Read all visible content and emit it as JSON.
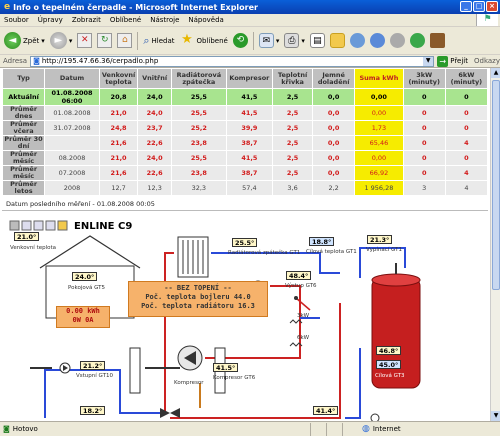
{
  "window": {
    "title": "Info o tepelném čerpadle - Microsoft Internet Explorer"
  },
  "menu": [
    "Soubor",
    "Úpravy",
    "Zobrazit",
    "Oblíbené",
    "Nástroje",
    "Nápověda"
  ],
  "toolbar": {
    "back_label": "Zpět",
    "search_label": "Hledat",
    "favorites_label": "Oblíbené"
  },
  "address": {
    "label": "Adresa",
    "url": "http://195.47.66.36/cerpadlo.php",
    "go_label": "Přejít",
    "links_label": "Odkazy"
  },
  "table": {
    "headers": [
      "Typ",
      "Datum",
      "Venkovní teplota",
      "Vnitřní",
      "Radiátorová zpátečka",
      "Kompresor",
      "Teplotní křivka",
      "Jemné doladění",
      "Suma kWh",
      "3kW (minuty)",
      "6kW (minuty)"
    ],
    "rows": [
      {
        "type": "Aktuální",
        "date": "01.08.2008 06:00",
        "v": [
          "20,8",
          "24,0",
          "25,5",
          "41,5",
          "2,5",
          "0,0",
          "0,00",
          "0",
          "0"
        ],
        "now": true
      },
      {
        "type": "Průměr dnes",
        "date": "01.08.2008",
        "v": [
          "21,0",
          "24,0",
          "25,5",
          "41,5",
          "2,5",
          "0,0",
          "0,00",
          "0",
          "0"
        ],
        "now": false
      },
      {
        "type": "Průměr včera",
        "date": "31.07.2008",
        "v": [
          "24,8",
          "23,7",
          "25,2",
          "39,9",
          "2,5",
          "0,0",
          "1,73",
          "0",
          "0"
        ],
        "now": false
      },
      {
        "type": "Průměr 30 dní",
        "date": "",
        "v": [
          "21,6",
          "22,6",
          "23,8",
          "38,7",
          "2,5",
          "0,0",
          "65,46",
          "0",
          "4"
        ],
        "now": false
      },
      {
        "type": "Průměr měsíc",
        "date": "08.2008",
        "v": [
          "21,0",
          "24,0",
          "25,5",
          "41,5",
          "2,5",
          "0,0",
          "0,00",
          "0",
          "0"
        ],
        "now": false
      },
      {
        "type": "Průměr měsíc",
        "date": "07.2008",
        "v": [
          "21,6",
          "22,6",
          "23,8",
          "38,7",
          "2,5",
          "0,0",
          "66,92",
          "0",
          "4"
        ],
        "now": false
      },
      {
        "type": "Průměr letos",
        "date": "2008",
        "v": [
          "12,7",
          "12,3",
          "32,3",
          "57,4",
          "3,6",
          "2,2",
          "1 956,28",
          "3",
          "4"
        ],
        "now": false,
        "plain": true
      }
    ],
    "last_measurement": "Datum posledního měření - 01.08.2008 00:05"
  },
  "scheme": {
    "title": "ENLINE C9",
    "outdoor_temp": "21.0°",
    "outdoor_label": "Venkovní teplota",
    "room_temp": "24.0°",
    "room_label": "Pokojová GT5",
    "radiator_return": "25.5°",
    "radiator_return_label": "Radiátorová zpátečka GT1",
    "target_temp": "18.8°",
    "target_label": "Cílová teplota GT1",
    "outlet_temp": "21.3°",
    "outlet_label": "Vypínací GT1",
    "gt6_temp": "48.4°",
    "gt6_label": "Výstup GT6",
    "heater_3kw": "3kW",
    "heater_6kw": "6kW",
    "info_lines": [
      "-- BEZ TOPENÍ --",
      "Poč. teplota bojleru 44.0",
      "Poč. teplota radiátoru 16.3"
    ],
    "kwh_value": "0.00 kWh",
    "power_values": "0W  0A",
    "brine_in": "21.2°",
    "brine_in_label": "Vstupní GT10",
    "compressor_label": "Kompresor",
    "compressor_temp": "41.5°",
    "compressor_temp_label": "Kompresor GT6",
    "boiler_top": "46.8°",
    "boiler_bottom": "45.0°",
    "boiler_label": "Cílová GT3",
    "bottom_left_temp": "18.2°",
    "bottom_mid_temp": "41.4°"
  },
  "status": {
    "left": "Hotovo",
    "zone": "Internet"
  }
}
